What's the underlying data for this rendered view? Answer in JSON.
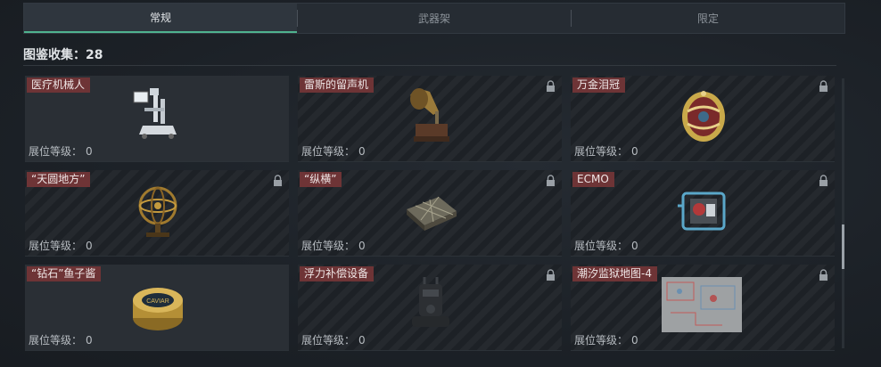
{
  "tabs": [
    {
      "label": "常规",
      "active": true
    },
    {
      "label": "武器架",
      "active": false
    },
    {
      "label": "限定",
      "active": false
    }
  ],
  "collection": {
    "label": "图鉴收集：",
    "count": "28"
  },
  "level_label": "展位等级：",
  "items": [
    {
      "name": "医疗机械人",
      "level": "0",
      "locked": false,
      "icon": "medical-robot-icon"
    },
    {
      "name": "雷斯的留声机",
      "level": "0",
      "locked": true,
      "icon": "gramophone-icon"
    },
    {
      "name": "万金泪冠",
      "level": "0",
      "locked": true,
      "icon": "jeweled-egg-icon"
    },
    {
      "name": "“天圆地方”",
      "level": "0",
      "locked": true,
      "icon": "armillary-sphere-icon"
    },
    {
      "name": "“纵横”",
      "level": "0",
      "locked": true,
      "icon": "chessboard-icon"
    },
    {
      "name": "ECMO",
      "level": "0",
      "locked": true,
      "icon": "ecmo-machine-icon"
    },
    {
      "name": "“钻石”鱼子酱",
      "level": "0",
      "locked": false,
      "icon": "caviar-tin-icon",
      "tin_text": "CAVIAR"
    },
    {
      "name": "浮力补偿设备",
      "level": "0",
      "locked": true,
      "icon": "buoyancy-device-icon"
    },
    {
      "name": "潮汐监狱地图-4",
      "level": "0",
      "locked": true,
      "icon": "prison-map-icon"
    }
  ],
  "colors": {
    "accent": "#4fb38f",
    "name_tag": "#6e3436"
  }
}
